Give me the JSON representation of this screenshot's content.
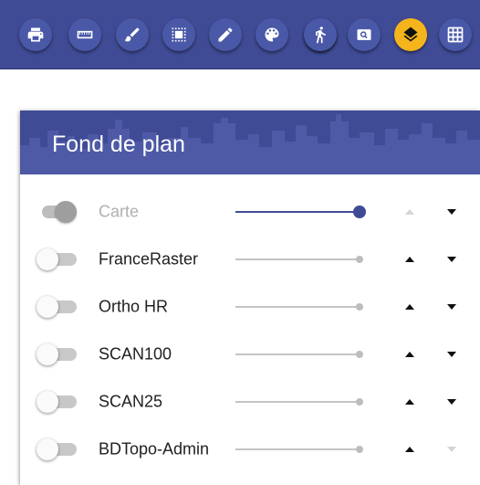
{
  "colors": {
    "primary": "#3f4b94",
    "accent": "#f5b41c",
    "disabled_text": "#b0b0b0"
  },
  "toolbar": {
    "buttons": [
      {
        "icon": "print-icon",
        "active": false
      },
      {
        "icon": "ruler-icon",
        "active": false
      },
      {
        "icon": "brush-icon",
        "active": false
      },
      {
        "icon": "selection-icon",
        "active": false
      },
      {
        "icon": "pencil-icon",
        "active": false
      },
      {
        "icon": "palette-icon",
        "active": false
      },
      {
        "icon": "pin-icon",
        "active": false
      },
      {
        "icon": "walk-icon",
        "active": false
      },
      {
        "icon": "zoom-box-icon",
        "active": false
      },
      {
        "icon": "layers-icon",
        "active": true
      },
      {
        "icon": "grid-icon",
        "active": false
      }
    ]
  },
  "panel": {
    "title": "Fond de plan",
    "layers": [
      {
        "label": "Carte",
        "enabled": false,
        "opacity": 1.0,
        "slider_active": true,
        "up_enabled": false,
        "down_enabled": true
      },
      {
        "label": "FranceRaster",
        "enabled": false,
        "opacity": 1.0,
        "slider_active": false,
        "up_enabled": true,
        "down_enabled": true
      },
      {
        "label": "Ortho HR",
        "enabled": false,
        "opacity": 1.0,
        "slider_active": false,
        "up_enabled": true,
        "down_enabled": true
      },
      {
        "label": "SCAN100",
        "enabled": false,
        "opacity": 1.0,
        "slider_active": false,
        "up_enabled": true,
        "down_enabled": true
      },
      {
        "label": "SCAN25",
        "enabled": false,
        "opacity": 1.0,
        "slider_active": false,
        "up_enabled": true,
        "down_enabled": true
      },
      {
        "label": "BDTopo-Admin",
        "enabled": false,
        "opacity": 1.0,
        "slider_active": false,
        "up_enabled": true,
        "down_enabled": false
      }
    ]
  }
}
